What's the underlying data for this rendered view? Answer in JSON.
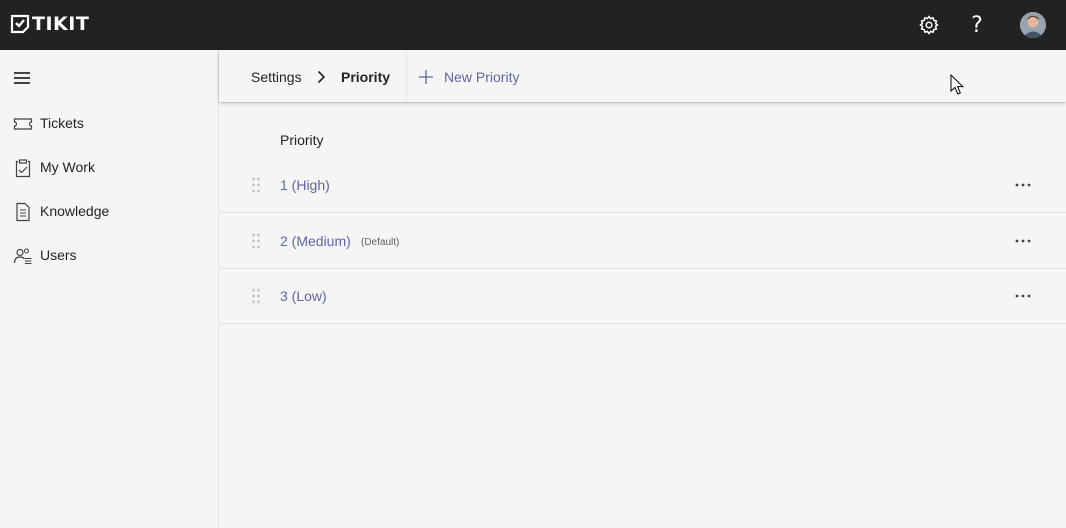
{
  "app": {
    "name": "TIKIT"
  },
  "topbar": {
    "help_label": "?"
  },
  "sidebar": {
    "items": [
      {
        "label": "Tickets",
        "icon": "ticket-icon"
      },
      {
        "label": "My Work",
        "icon": "clipboard-icon"
      },
      {
        "label": "Knowledge",
        "icon": "document-icon"
      },
      {
        "label": "Users",
        "icon": "people-icon"
      }
    ]
  },
  "breadcrumb": {
    "parent": "Settings",
    "current": "Priority"
  },
  "commandbar": {
    "new_label": "New Priority"
  },
  "list": {
    "header": "Priority",
    "rows": [
      {
        "name": "1 (High)",
        "tag": ""
      },
      {
        "name": "2 (Medium)",
        "tag": "(Default)"
      },
      {
        "name": "3 (Low)",
        "tag": ""
      }
    ]
  },
  "colors": {
    "topbar": "#222222",
    "accent": "#6264a7",
    "background": "#f5f5f5"
  }
}
